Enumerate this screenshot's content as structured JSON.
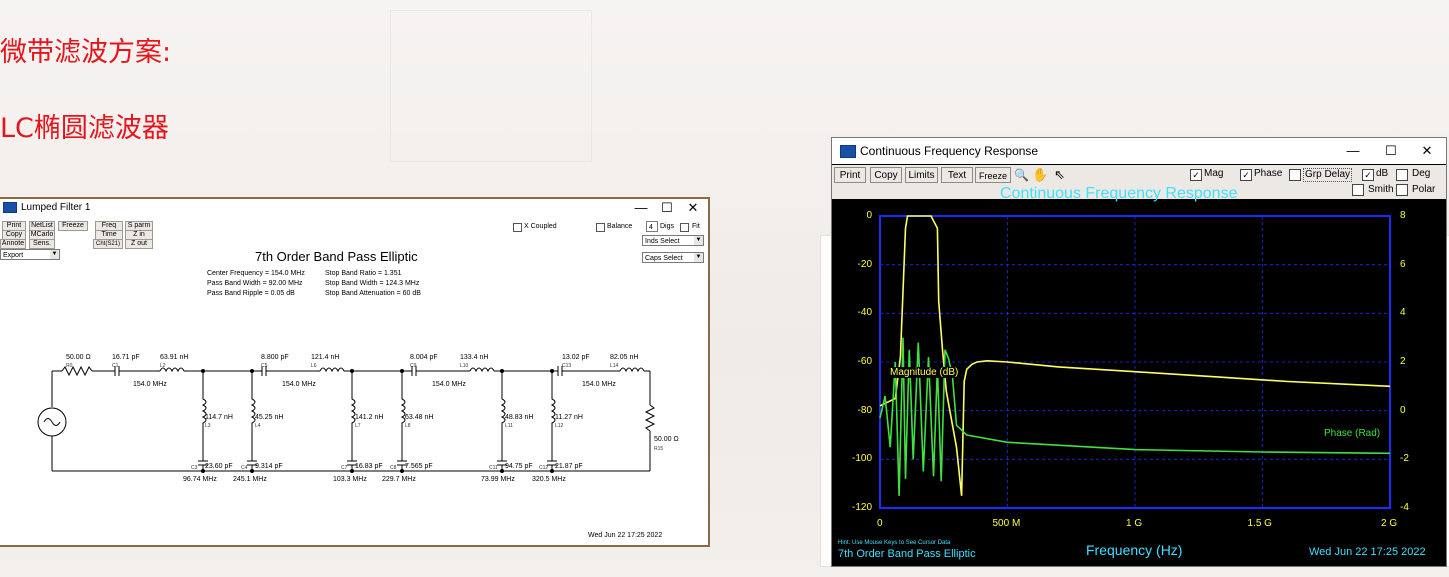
{
  "slide": {
    "heading1": "微带滤波方案:",
    "heading2": "LC椭圆滤波器",
    "accent_color": "#e8141c"
  },
  "lumped": {
    "title": "Lumped Filter 1",
    "window_controls": {
      "minimize": "—",
      "maximize": "☐",
      "close": "✕"
    },
    "buttons": {
      "print": "Print",
      "netlist": "NetList",
      "freeze": "Freeze",
      "copy": "Copy",
      "mcarlo": "MCarlo",
      "annote": "Annote",
      "sens": "Sens.",
      "freq": "Freq",
      "time": "Time",
      "cht": "Cht(S21)",
      "sparm": "S parm",
      "zin": "Z in",
      "zout": "Z out"
    },
    "export_select": "Export",
    "x_coupled": "X Coupled",
    "balance": "Balance",
    "digs_value": "4",
    "digs_label": "Digs",
    "fit_label": "Fit",
    "inds_select": "Inds Select",
    "caps_select": "Caps Select",
    "schematic_title": "7th Order Band Pass Elliptic",
    "specs": {
      "center": "Center Frequency = 154.0 MHz",
      "pbw": "Pass Band Width = 92.00 MHz",
      "ripple": "Pass Band Ripple = 0.05 dB",
      "sbratio": "Stop Band Ratio = 1.351",
      "sbw": "Stop Band Width = 124.3 MHz",
      "atten": "Stop Band Attenuation = 60 dB"
    },
    "components": {
      "r0": "50.00 Ω",
      "r0_ref": "R0",
      "c1": "16.71 pF",
      "c1_ref": "C1",
      "l2": "63.91 nH",
      "l2_ref": "L2",
      "res1": "154.0 MHz",
      "l3": "114.7 nH",
      "l3_ref": "L3",
      "c3": "23.60 pF",
      "c3_ref": "C3",
      "f3": "96.74 MHz",
      "l4": "45.25 nH",
      "l4_ref": "L4",
      "c4": "9.314 pF",
      "c4_ref": "C4",
      "f4": "245.1 MHz",
      "c5": "8.800 pF",
      "c5_ref": "C5",
      "l6": "121.4 nH",
      "l6_ref": "L6",
      "res2": "154.0 MHz",
      "l7": "141.2 nH",
      "l7_ref": "L7",
      "c7": "16.83 pF",
      "c7_ref": "C7",
      "f7": "103.3 MHz",
      "l8": "63.48 nH",
      "l8_ref": "L8",
      "c8": "7.565 pF",
      "c8_ref": "C8",
      "f8": "229.7 MHz",
      "c9": "8.004 pF",
      "c9_ref": "C9",
      "l10": "133.4 nH",
      "l10_ref": "L10",
      "res3": "154.0 MHz",
      "l11": "48.83 nH",
      "l11_ref": "L11",
      "c11": "94.75 pF",
      "c11_ref": "C11",
      "f11": "73.99 MHz",
      "l12": "11.27 nH",
      "l12_ref": "L12",
      "c12": "21.87 pF",
      "c12_ref": "C12",
      "f12": "320.5 MHz",
      "c13": "13.02 pF",
      "c13_ref": "C13",
      "l14": "82.05 nH",
      "l14_ref": "L14",
      "res4": "154.0 MHz",
      "r15": "50.00 Ω",
      "r15_ref": "R15"
    },
    "timestamp": "Wed Jun 22 17:25 2022"
  },
  "cfr": {
    "title": "Continuous Frequency Response",
    "window_controls": {
      "minimize": "—",
      "maximize": "☐",
      "close": "✕"
    },
    "buttons": {
      "print": "Print",
      "copy": "Copy",
      "limits": "Limits",
      "text": "Text",
      "freeze": "Freeze"
    },
    "checks": {
      "mag": "Mag",
      "phase": "Phase",
      "grp_delay": "Grp Delay",
      "db": "dB",
      "deg": "Deg",
      "smith": "Smith",
      "polar": "Polar"
    },
    "plot_title": "Continuous Frequency Response",
    "mag_label": "Magnitude (dB)",
    "phase_label": "Phase (Rad)",
    "hint": "Hint: Use Mouse Keys to See Cursor Data",
    "filter_name": "7th Order Band Pass Elliptic",
    "xlabel": "Frequency (Hz)",
    "timestamp": "Wed Jun 22 17:25 2022",
    "y_left_ticks": [
      "0",
      "-20",
      "-40",
      "-60",
      "-80",
      "-100",
      "-120"
    ],
    "y_right_ticks": [
      "8",
      "6",
      "4",
      "2",
      "0",
      "-2",
      "-4"
    ],
    "x_ticks": [
      "0",
      "500 M",
      "1 G",
      "1.5 G",
      "2 G"
    ],
    "colors": {
      "bg": "#000000",
      "axis": "#1a2cff",
      "mag": "#ffff60",
      "phase": "#40e040",
      "title": "#40e0ff"
    }
  },
  "chart_data": {
    "type": "line",
    "title": "Continuous Frequency Response",
    "xlabel": "Frequency (Hz)",
    "ylabel": "Magnitude (dB)",
    "y2label": "Phase (Rad)",
    "xlim": [
      0,
      2000000000
    ],
    "ylim": [
      -120,
      0
    ],
    "y2lim": [
      -4,
      8
    ],
    "grid": true,
    "series": [
      {
        "name": "Magnitude (dB)",
        "axis": "left",
        "x": [
          0,
          60000000,
          80000000,
          100000000,
          108000000,
          154000000,
          200000000,
          225000000,
          230000000,
          245000000,
          260000000,
          300000000,
          320000000,
          330000000,
          340000000,
          360000000,
          380000000,
          420000000,
          500000000,
          700000000,
          1000000000,
          1300000000,
          1600000000,
          2000000000
        ],
        "y": [
          -78,
          -75,
          -58,
          -5,
          0,
          0,
          0,
          -5,
          -35,
          -55,
          -72,
          -95,
          -115,
          -68,
          -63,
          -61,
          -60,
          -59.5,
          -60,
          -62,
          -64,
          -66,
          -68,
          -70
        ]
      },
      {
        "name": "Phase (Rad)",
        "axis": "right",
        "x": [
          0,
          20000000,
          40000000,
          60000000,
          75000000,
          90000000,
          100000000,
          115000000,
          130000000,
          150000000,
          170000000,
          190000000,
          210000000,
          225000000,
          240000000,
          255000000,
          270000000,
          285000000,
          300000000,
          320000000,
          340000000,
          500000000,
          1000000000,
          1500000000,
          2000000000
        ],
        "y": [
          -0.3,
          0.6,
          -1.5,
          2.0,
          -3.5,
          3.0,
          -2.8,
          2.5,
          -2.0,
          2.8,
          -2.5,
          2.2,
          -2.7,
          1.8,
          -2.9,
          2.5,
          2.1,
          1.3,
          -0.6,
          -0.8,
          -1.0,
          -1.3,
          -1.6,
          -1.7,
          -1.75
        ]
      }
    ]
  }
}
